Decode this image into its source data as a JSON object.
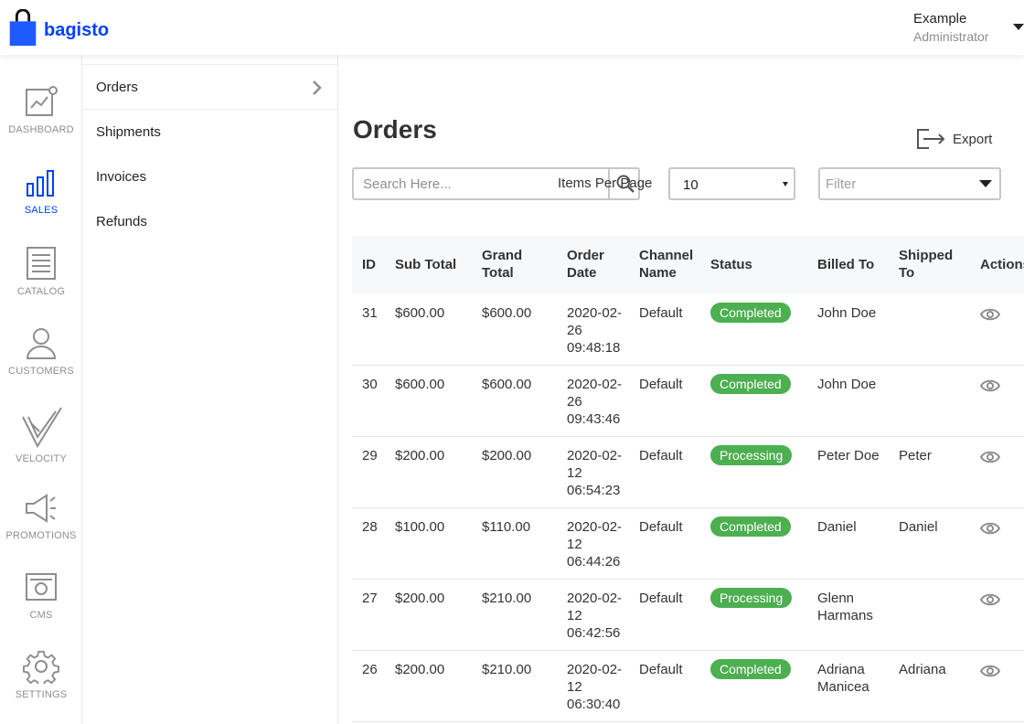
{
  "app": {
    "logo_text": "bagisto"
  },
  "user": {
    "name": "Example",
    "role": "Administrator"
  },
  "nav": [
    {
      "label": "DASHBOARD",
      "icon": "dashboard-icon",
      "active": false
    },
    {
      "label": "SALES",
      "icon": "sales-icon",
      "active": true
    },
    {
      "label": "CATALOG",
      "icon": "catalog-icon",
      "active": false
    },
    {
      "label": "CUSTOMERS",
      "icon": "customers-icon",
      "active": false
    },
    {
      "label": "VELOCITY",
      "icon": "velocity-icon",
      "active": false
    },
    {
      "label": "PROMOTIONS",
      "icon": "promotions-icon",
      "active": false
    },
    {
      "label": "CMS",
      "icon": "cms-icon",
      "active": false
    },
    {
      "label": "SETTINGS",
      "icon": "settings-icon",
      "active": false
    }
  ],
  "subnav": [
    {
      "label": "Orders",
      "active": true
    },
    {
      "label": "Shipments",
      "active": false
    },
    {
      "label": "Invoices",
      "active": false
    },
    {
      "label": "Refunds",
      "active": false
    }
  ],
  "page": {
    "title": "Orders",
    "export_label": "Export"
  },
  "toolbar": {
    "search_placeholder": "Search Here...",
    "items_per_page_label": "Items Per Page",
    "items_per_page_value": "10",
    "filter_placeholder": "Filter"
  },
  "table": {
    "headers": {
      "id": "ID",
      "sub_total": "Sub Total",
      "grand_total": "Grand Total",
      "order_date": "Order Date",
      "channel": "Channel Name",
      "status": "Status",
      "billed_to": "Billed To",
      "shipped_to": "Shipped To",
      "actions": "Actions"
    },
    "rows": [
      {
        "id": "31",
        "sub_total": "$600.00",
        "grand_total": "$600.00",
        "order_date": "2020-02-26 09:48:18",
        "channel": "Default",
        "status": "Completed",
        "billed_to": "John Doe",
        "shipped_to": ""
      },
      {
        "id": "30",
        "sub_total": "$600.00",
        "grand_total": "$600.00",
        "order_date": "2020-02-26 09:43:46",
        "channel": "Default",
        "status": "Completed",
        "billed_to": "John Doe",
        "shipped_to": ""
      },
      {
        "id": "29",
        "sub_total": "$200.00",
        "grand_total": "$200.00",
        "order_date": "2020-02-12 06:54:23",
        "channel": "Default",
        "status": "Processing",
        "billed_to": "Peter Doe",
        "shipped_to": "Peter"
      },
      {
        "id": "28",
        "sub_total": "$100.00",
        "grand_total": "$110.00",
        "order_date": "2020-02-12 06:44:26",
        "channel": "Default",
        "status": "Completed",
        "billed_to": "Daniel",
        "shipped_to": "Daniel"
      },
      {
        "id": "27",
        "sub_total": "$200.00",
        "grand_total": "$210.00",
        "order_date": "2020-02-12 06:42:56",
        "channel": "Default",
        "status": "Processing",
        "billed_to": "Glenn Harmans",
        "shipped_to": ""
      },
      {
        "id": "26",
        "sub_total": "$200.00",
        "grand_total": "$210.00",
        "order_date": "2020-02-12 06:30:40",
        "channel": "Default",
        "status": "Completed",
        "billed_to": "Adriana Manicea",
        "shipped_to": "Adriana"
      }
    ]
  },
  "colors": {
    "brand": "#0041ff",
    "badge": "#4caf50"
  }
}
